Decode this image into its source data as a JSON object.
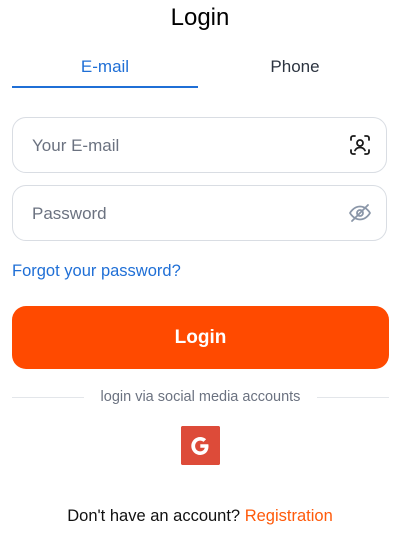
{
  "page": {
    "title": "Login"
  },
  "tabs": [
    {
      "label": "E-mail",
      "active": true
    },
    {
      "label": "Phone",
      "active": false
    }
  ],
  "form": {
    "email_placeholder": "Your E-mail",
    "email_value": "",
    "password_placeholder": "Password",
    "password_value": "",
    "forgot_link": "Forgot your password?",
    "login_button": "Login"
  },
  "social": {
    "divider_text": "login via social media accounts",
    "providers": [
      {
        "name": "Google",
        "icon": "google-icon",
        "letter": "G",
        "color": "#dd4b39"
      }
    ]
  },
  "footer": {
    "prompt": "Don't have an account?",
    "link": "Registration"
  },
  "colors": {
    "accent_blue": "#1f6fd6",
    "primary_orange": "#ff4a00",
    "link_orange": "#ff5a0a",
    "border": "#d9dde3",
    "muted_text": "#6b7280"
  }
}
